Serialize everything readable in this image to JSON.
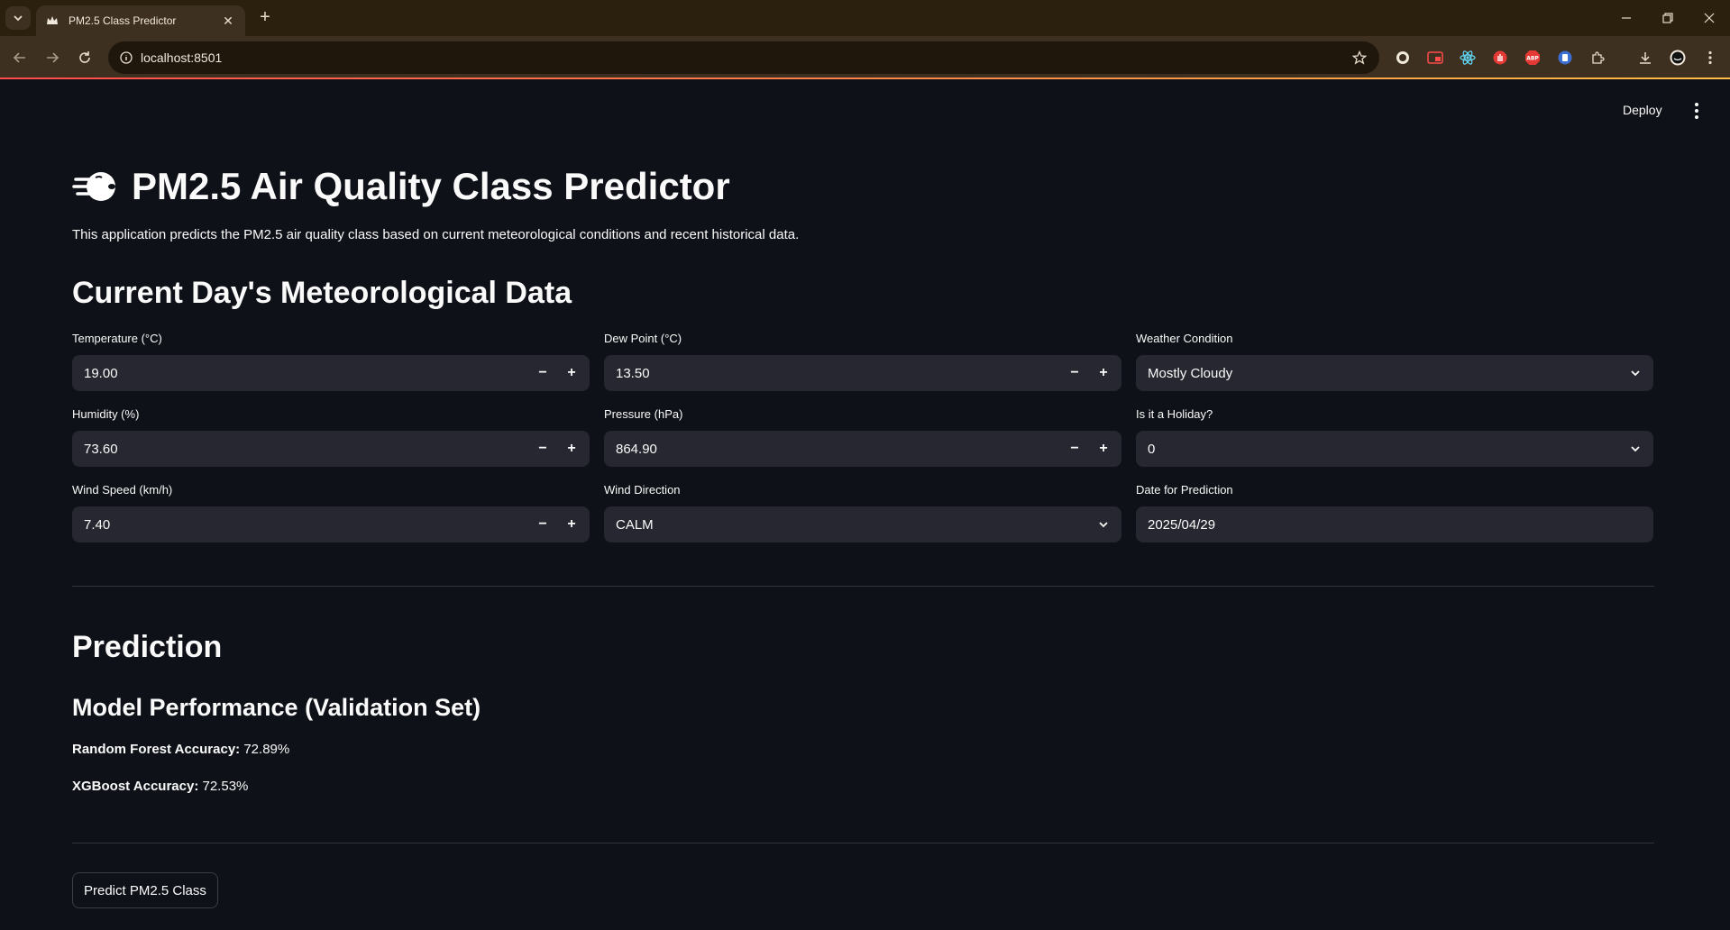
{
  "browser": {
    "tab_title": "PM2.5 Class Predictor",
    "url": "localhost:8501"
  },
  "header": {
    "deploy_label": "Deploy"
  },
  "app": {
    "title": "PM2.5 Air Quality Class Predictor",
    "title_icon": "wind-face-icon",
    "description": "This application predicts the PM2.5 air quality class based on current meteorological conditions and recent historical data.",
    "section_meteo": "Current Day's Meteorological Data",
    "fields": {
      "temperature": {
        "label": "Temperature (°C)",
        "value": "19.00"
      },
      "dew_point": {
        "label": "Dew Point (°C)",
        "value": "13.50"
      },
      "weather_condition": {
        "label": "Weather Condition",
        "value": "Mostly Cloudy"
      },
      "humidity": {
        "label": "Humidity (%)",
        "value": "73.60"
      },
      "pressure": {
        "label": "Pressure (hPa)",
        "value": "864.90"
      },
      "holiday": {
        "label": "Is it a Holiday?",
        "value": "0"
      },
      "wind_speed": {
        "label": "Wind Speed (km/h)",
        "value": "7.40"
      },
      "wind_direction": {
        "label": "Wind Direction",
        "value": "CALM"
      },
      "date": {
        "label": "Date for Prediction",
        "value": "2025/04/29"
      }
    },
    "section_prediction": "Prediction",
    "section_performance": "Model Performance (Validation Set)",
    "rf_label": "Random Forest Accuracy:",
    "rf_value": " 72.89%",
    "xgb_label": "XGBoost Accuracy:",
    "xgb_value": " 72.53%",
    "predict_button": "Predict PM2.5 Class"
  },
  "colors": {
    "background": "#0e1117",
    "input_bg": "#262730",
    "text": "#fafafa",
    "chrome_bg": "#3e3020",
    "accent": "#ff4b4b"
  }
}
